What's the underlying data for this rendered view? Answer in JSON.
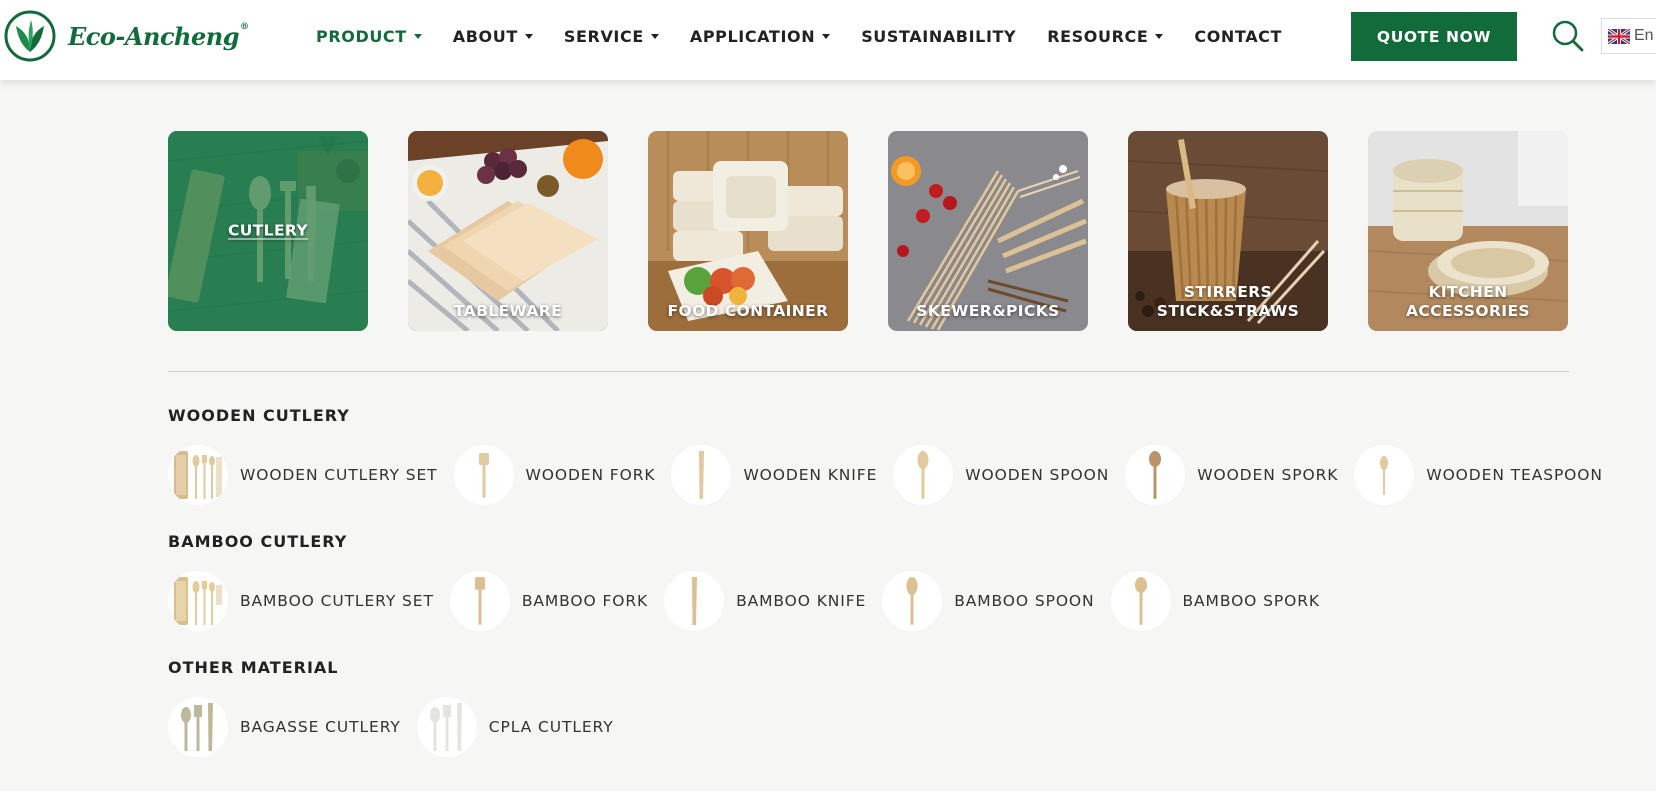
{
  "brand": {
    "name": "Eco-Ancheng",
    "reg_mark": "®",
    "color": "#116b3b"
  },
  "nav": {
    "items": [
      {
        "label": "PRODUCT",
        "dropdown": true,
        "active": true
      },
      {
        "label": "ABOUT",
        "dropdown": true,
        "active": false
      },
      {
        "label": "SERVICE",
        "dropdown": true,
        "active": false
      },
      {
        "label": "APPLICATION",
        "dropdown": true,
        "active": false
      },
      {
        "label": "SUSTAINABILITY",
        "dropdown": false,
        "active": false
      },
      {
        "label": "RESOURCE",
        "dropdown": true,
        "active": false
      },
      {
        "label": "CONTACT",
        "dropdown": false,
        "active": false
      }
    ],
    "quote_label": "QUOTE NOW",
    "search_icon": "search-icon",
    "language": "En"
  },
  "categories": [
    {
      "label": "CUTLERY",
      "active": true
    },
    {
      "label": "TABLEWARE",
      "active": false
    },
    {
      "label": "FOOD CONTAINER",
      "active": false
    },
    {
      "label": "SKEWER&PICKS",
      "active": false
    },
    {
      "label": "STIRRERS STICK&STRAWS",
      "active": false
    },
    {
      "label": "KITCHEN ACCESSORIES",
      "active": false
    }
  ],
  "sections": [
    {
      "title": "WOODEN CUTLERY",
      "items": [
        {
          "label": "WOODEN CUTLERY SET",
          "icon": "cutlery-set-icon"
        },
        {
          "label": "WOODEN FORK",
          "icon": "fork-icon"
        },
        {
          "label": "WOODEN KNIFE",
          "icon": "knife-icon"
        },
        {
          "label": "WOODEN SPOON",
          "icon": "spoon-icon"
        },
        {
          "label": "WOODEN SPORK",
          "icon": "spork-icon"
        },
        {
          "label": "WOODEN TEASPOON",
          "icon": "teaspoon-icon"
        }
      ]
    },
    {
      "title": "BAMBOO CUTLERY",
      "items": [
        {
          "label": "BAMBOO CUTLERY SET",
          "icon": "cutlery-set-icon"
        },
        {
          "label": "BAMBOO FORK",
          "icon": "fork-icon"
        },
        {
          "label": "BAMBOO KNIFE",
          "icon": "knife-icon"
        },
        {
          "label": "BAMBOO SPOON",
          "icon": "spoon-icon"
        },
        {
          "label": "BAMBOO SPORK",
          "icon": "spork-icon"
        }
      ]
    },
    {
      "title": "OTHER MATERIAL",
      "items": [
        {
          "label": "BAGASSE CUTLERY",
          "icon": "bagasse-cutlery-icon"
        },
        {
          "label": "CPLA CUTLERY",
          "icon": "cpla-cutlery-icon"
        }
      ]
    }
  ]
}
